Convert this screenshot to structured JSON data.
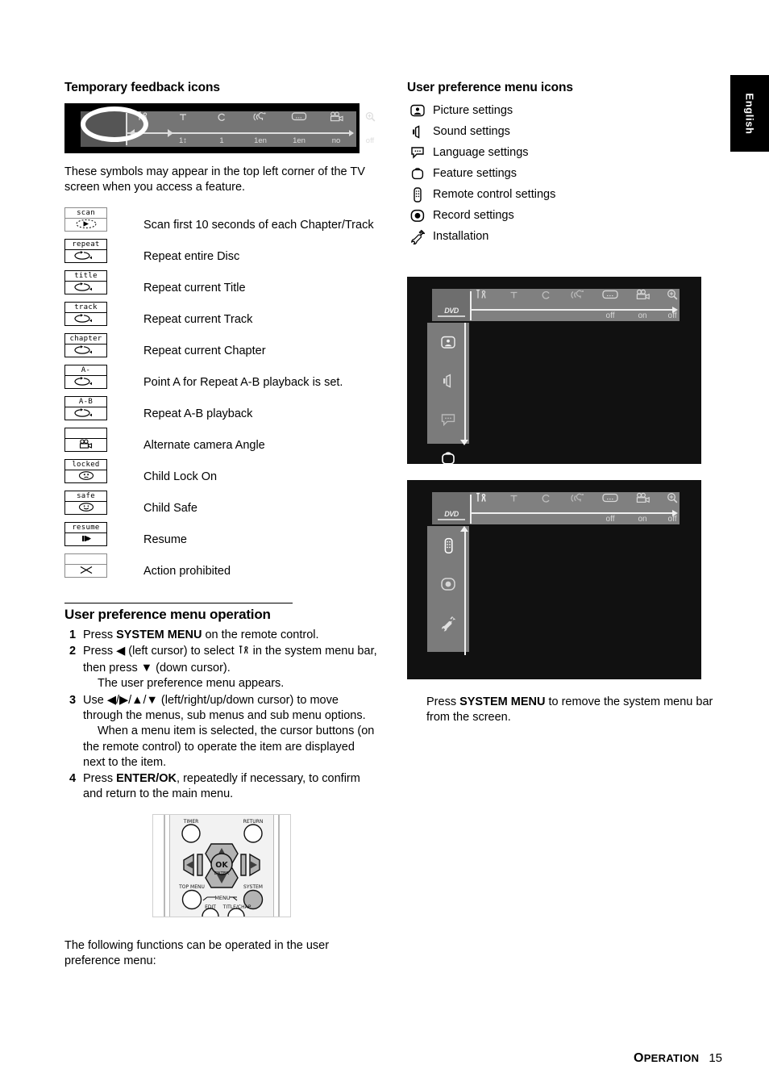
{
  "page": {
    "language_tab": "English",
    "footer_section": "OPERATION",
    "footer_page": "15"
  },
  "left_column": {
    "heading": "Temporary feedback icons",
    "feedback_bar": {
      "slots": [
        {
          "icon": "system-menu-icon",
          "value": ""
        },
        {
          "icon": "title-icon",
          "value": "1↕"
        },
        {
          "icon": "chapter-icon",
          "value": "1"
        },
        {
          "icon": "audio-language-icon",
          "value": "1en"
        },
        {
          "icon": "subtitle-icon",
          "value": "1en"
        },
        {
          "icon": "camera-angle-icon",
          "value": "no"
        },
        {
          "icon": "zoom-icon",
          "value": "off"
        }
      ]
    },
    "intro": "These symbols may appear in the top left corner of the TV screen when you access a feature.",
    "icon_rows": [
      {
        "badge": "scan",
        "glyph": "scan-icon",
        "text": "Scan first 10 seconds of each Chapter/Track"
      },
      {
        "badge": "repeat",
        "glyph": "repeat-icon",
        "text": "Repeat entire Disc"
      },
      {
        "badge": "title",
        "glyph": "repeat-icon",
        "text": "Repeat current Title"
      },
      {
        "badge": "track",
        "glyph": "repeat-icon",
        "text": "Repeat current Track"
      },
      {
        "badge": "chapter",
        "glyph": "repeat-icon",
        "text": "Repeat current Chapter"
      },
      {
        "badge": "A-",
        "glyph": "repeat-icon",
        "text": "Point A for Repeat A-B playback is set."
      },
      {
        "badge": "A-B",
        "glyph": "repeat-icon",
        "text": "Repeat A-B playback"
      },
      {
        "badge": "",
        "glyph": "camera-angle-icon",
        "text": "Alternate camera Angle"
      },
      {
        "badge": "locked",
        "glyph": "sad-face-icon",
        "text": "Child Lock On"
      },
      {
        "badge": "safe",
        "glyph": "happy-face-icon",
        "text": "Child Safe"
      },
      {
        "badge": "resume",
        "glyph": "resume-icon",
        "text": "Resume"
      },
      {
        "badge": "",
        "glyph": "prohibited-icon",
        "text": "Action prohibited"
      }
    ],
    "operation": {
      "heading": "User preference menu operation",
      "steps": [
        {
          "num": "1",
          "parts": [
            {
              "t": "Press ",
              "b": false
            },
            {
              "t": "SYSTEM MENU",
              "b": true
            },
            {
              "t": " on the remote control.",
              "b": false
            }
          ],
          "sub": ""
        },
        {
          "num": "2",
          "parts": [
            {
              "t": "Press ◀ (left cursor) to select ",
              "b": false
            },
            {
              "t": "↑⑂",
              "b": false
            },
            {
              "t": " in the system menu bar, then press ▼ (down cursor).",
              "b": false
            }
          ],
          "sub": "The user preference menu appears."
        },
        {
          "num": "3",
          "parts": [
            {
              "t": "Use ◀/▶/▲/▼ (left/right/up/down cursor) to move through the menus, sub menus and sub menu options.",
              "b": false
            }
          ],
          "sub": "When a menu item is selected, the cursor buttons (on the remote control) to operate the item are displayed next to the item."
        },
        {
          "num": "4",
          "parts": [
            {
              "t": "Press ",
              "b": false
            },
            {
              "t": "ENTER/OK",
              "b": true
            },
            {
              "t": ", repeatedly if necessary, to confirm and return to the main menu.",
              "b": false
            }
          ],
          "sub": ""
        }
      ]
    },
    "remote": {
      "labels": {
        "timer": "TIMER",
        "return": "RETURN",
        "ok": "OK",
        "enter": "ENTER",
        "top_menu": "TOP MENU",
        "system": "SYSTEM",
        "menu": "MENU",
        "edit": "EDIT",
        "title_chap": "TITLE/CHAP"
      }
    },
    "following_text": "The following functions can be operated in the user preference menu:"
  },
  "right_column": {
    "heading": "User preference menu icons",
    "pref_icons": [
      {
        "icon": "picture-settings-icon",
        "label": "Picture settings"
      },
      {
        "icon": "sound-settings-icon",
        "label": "Sound settings"
      },
      {
        "icon": "language-settings-icon",
        "label": "Language settings"
      },
      {
        "icon": "feature-settings-icon",
        "label": "Feature settings"
      },
      {
        "icon": "remote-control-icon",
        "label": "Remote control settings"
      },
      {
        "icon": "record-settings-icon",
        "label": "Record settings"
      },
      {
        "icon": "installation-icon",
        "label": "Installation"
      }
    ],
    "screens": [
      {
        "dvd_label": "DVD",
        "menu_slots": [
          {
            "icon": "system-menu-icon",
            "value": ""
          },
          {
            "icon": "title-icon",
            "value": ""
          },
          {
            "icon": "chapter-icon",
            "value": ""
          },
          {
            "icon": "audio-language-icon",
            "value": ""
          },
          {
            "icon": "subtitle-icon",
            "value": "off"
          },
          {
            "icon": "camera-angle-icon",
            "value": "on"
          },
          {
            "icon": "zoom-icon",
            "value": "off"
          }
        ],
        "side_icons": [
          "picture-settings-icon",
          "sound-settings-icon",
          "language-settings-icon",
          "feature-settings-icon"
        ],
        "scroll_direction": "down"
      },
      {
        "dvd_label": "DVD",
        "menu_slots": [
          {
            "icon": "system-menu-icon",
            "value": ""
          },
          {
            "icon": "title-icon",
            "value": ""
          },
          {
            "icon": "chapter-icon",
            "value": ""
          },
          {
            "icon": "audio-language-icon",
            "value": ""
          },
          {
            "icon": "subtitle-icon",
            "value": "off"
          },
          {
            "icon": "camera-angle-icon",
            "value": "on"
          },
          {
            "icon": "zoom-icon",
            "value": "off"
          }
        ],
        "side_icons": [
          "remote-control-icon",
          "record-settings-icon",
          "installation-icon"
        ],
        "scroll_direction": "up"
      }
    ],
    "note": {
      "parts": [
        {
          "t": "Press ",
          "b": false
        },
        {
          "t": "SYSTEM MENU",
          "b": true
        },
        {
          "t": " to remove the system menu bar from the screen.",
          "b": false
        }
      ]
    }
  }
}
